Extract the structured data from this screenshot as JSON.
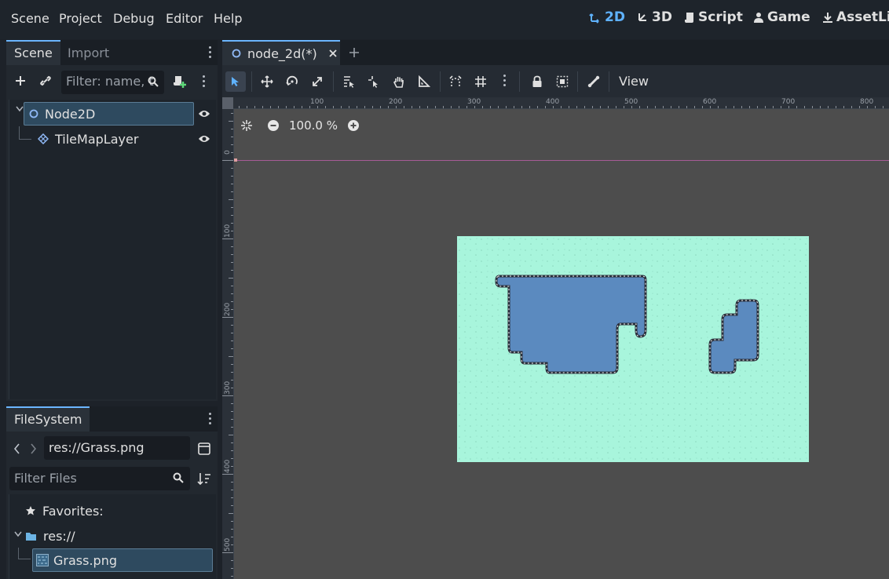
{
  "menu": {
    "items": [
      "Scene",
      "Project",
      "Debug",
      "Editor",
      "Help"
    ],
    "workspaces": [
      {
        "label": "2D",
        "icon": "2d-icon",
        "active": true
      },
      {
        "label": "3D",
        "icon": "3d-icon",
        "active": false
      },
      {
        "label": "Script",
        "icon": "script-icon",
        "active": false
      },
      {
        "label": "Game",
        "icon": "game-icon",
        "active": false
      },
      {
        "label": "AssetLib",
        "icon": "assetlib-icon",
        "active": false
      }
    ]
  },
  "scene_dock": {
    "tabs": [
      "Scene",
      "Import"
    ],
    "filter_placeholder": "Filter: name, t",
    "tree": [
      {
        "label": "Node2D",
        "icon": "node2d-icon",
        "selected": true
      },
      {
        "label": "TileMapLayer",
        "icon": "tilemaplayer-icon",
        "selected": false
      }
    ]
  },
  "fs_dock": {
    "tab": "FileSystem",
    "path": "res://Grass.png",
    "filter_placeholder": "Filter Files",
    "favorites_label": "Favorites:",
    "root_label": "res://",
    "file_label": "Grass.png"
  },
  "editor": {
    "scene_tab": "node_2d(*)",
    "view_label": "View",
    "zoom": "100.0 %",
    "ruler_h": [
      "100",
      "200",
      "300",
      "400",
      "500",
      "600",
      "700",
      "800"
    ],
    "ruler_v": [
      "0",
      "100",
      "200",
      "300",
      "400",
      "500"
    ]
  },
  "colors": {
    "accent": "#5fb2ff",
    "viewport_bg": "#4d4d4d",
    "grass": "#a8f5dc",
    "water": "#5b8abf"
  }
}
